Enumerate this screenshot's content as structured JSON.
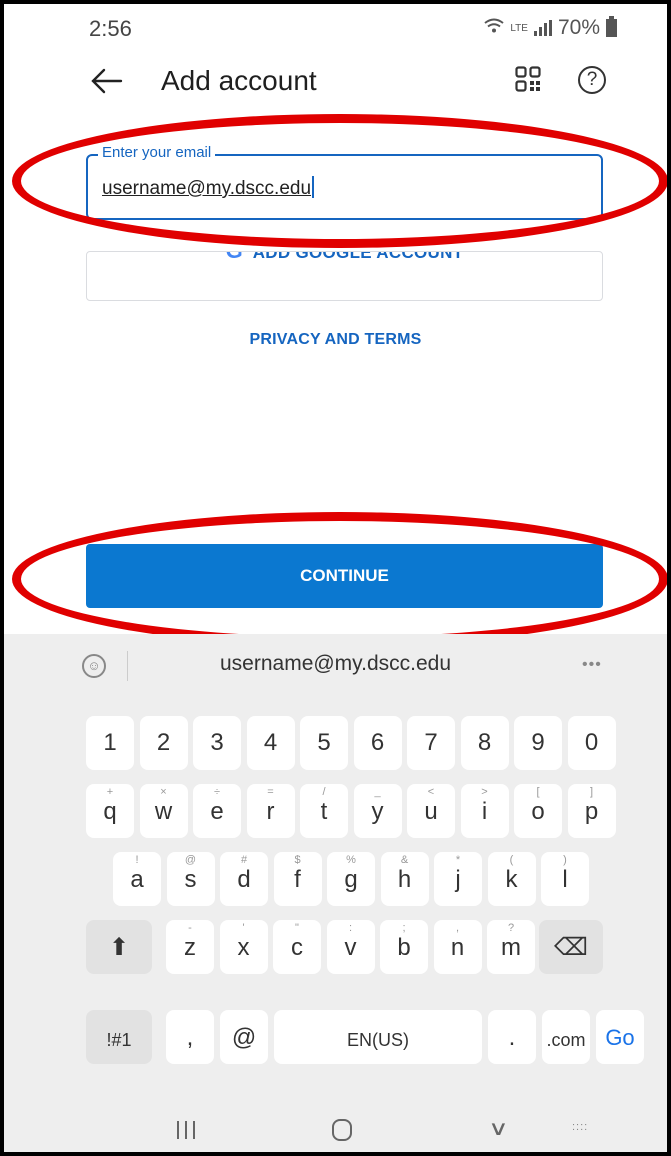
{
  "status_bar": {
    "time": "2:56",
    "network_label": "LTE",
    "battery": "70%"
  },
  "app_bar": {
    "title": "Add account"
  },
  "email_field": {
    "label": "Enter your email",
    "value": "username@my.dscc.edu"
  },
  "google_button": {
    "label": "ADD GOOGLE ACCOUNT",
    "icon": "G"
  },
  "privacy_link": "PRIVACY AND TERMS",
  "continue_button": "CONTINUE",
  "keyboard": {
    "suggestion": "username@my.dscc.edu",
    "emoji_glyph": "☺",
    "more_glyph": "•••",
    "row_numbers": [
      "1",
      "2",
      "3",
      "4",
      "5",
      "6",
      "7",
      "8",
      "9",
      "0"
    ],
    "row1": [
      {
        "k": "q",
        "a": "+"
      },
      {
        "k": "w",
        "a": "×"
      },
      {
        "k": "e",
        "a": "÷"
      },
      {
        "k": "r",
        "a": "="
      },
      {
        "k": "t",
        "a": "/"
      },
      {
        "k": "y",
        "a": "_"
      },
      {
        "k": "u",
        "a": "<"
      },
      {
        "k": "i",
        "a": ">"
      },
      {
        "k": "o",
        "a": "["
      },
      {
        "k": "p",
        "a": "]"
      }
    ],
    "row2": [
      {
        "k": "a",
        "a": "!"
      },
      {
        "k": "s",
        "a": "@"
      },
      {
        "k": "d",
        "a": "#"
      },
      {
        "k": "f",
        "a": "$"
      },
      {
        "k": "g",
        "a": "%"
      },
      {
        "k": "h",
        "a": "&"
      },
      {
        "k": "j",
        "a": "*"
      },
      {
        "k": "k",
        "a": "("
      },
      {
        "k": "l",
        "a": ")"
      }
    ],
    "row3": [
      {
        "k": "z",
        "a": "-"
      },
      {
        "k": "x",
        "a": "'"
      },
      {
        "k": "c",
        "a": "\""
      },
      {
        "k": "v",
        "a": ":"
      },
      {
        "k": "b",
        "a": ";"
      },
      {
        "k": "n",
        "a": ","
      },
      {
        "k": "m",
        "a": "?"
      }
    ],
    "shift_glyph": "⬆",
    "backspace_glyph": "⌫",
    "symbols": "!#1",
    "comma": ",",
    "at": "@",
    "space": "EN(US)",
    "period": ".",
    "dotcom": ".com",
    "go": "Go"
  },
  "nav_bar": {
    "back_glyph": "∨",
    "keyboard_glyph": "::::"
  },
  "colors": {
    "accent": "#1565c0",
    "continue": "#0b78d0",
    "annotation": "#e00000",
    "keyboard_bg": "#eeeeee"
  }
}
